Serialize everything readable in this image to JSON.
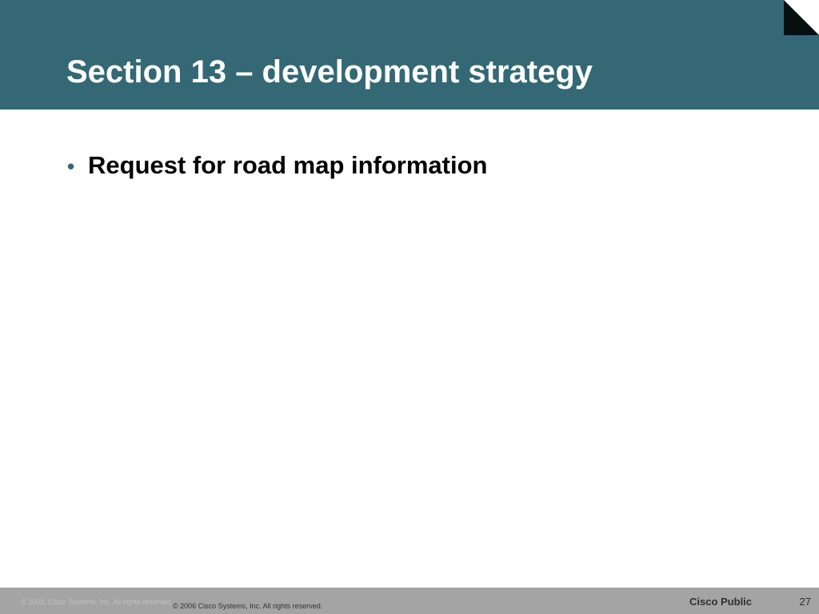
{
  "slide": {
    "title": "Section 13 – development strategy",
    "bullets": [
      {
        "marker": "•",
        "text": "Request for road map information"
      }
    ]
  },
  "footer": {
    "ghost_copyright": "© 2003, Cisco Systems, Inc. All rights reserved.",
    "copyright": "© 2006 Cisco Systems, Inc. All rights reserved.",
    "classification": "Cisco Public",
    "page_number": "27"
  },
  "colors": {
    "header_band": "#336874",
    "footer_band": "#a4a4a4",
    "title_text": "#ffffff",
    "body_text": "#000000",
    "bullet_marker": "#336874"
  },
  "icons": {
    "corner": "page-corner-fold-icon"
  }
}
